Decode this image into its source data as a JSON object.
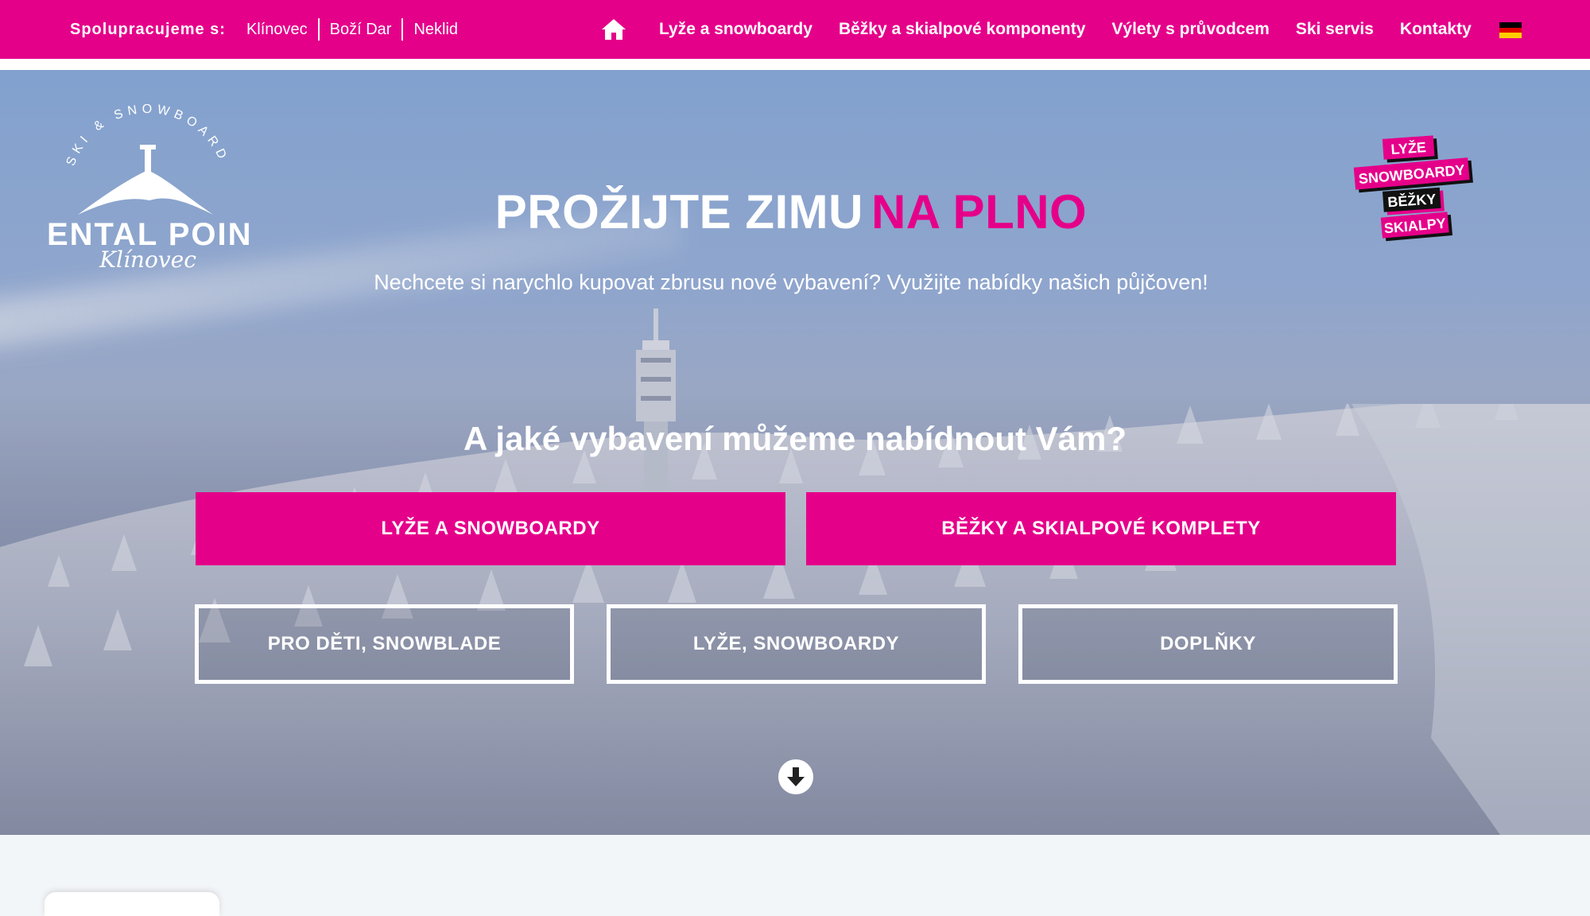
{
  "topbar": {
    "partners_label": "Spolupracujeme s:",
    "partners": [
      "Klínovec",
      "Boží Dar",
      "Neklid"
    ],
    "home_icon": "home-icon",
    "nav": [
      "Lyže a snowboardy",
      "Běžky a skialpové komponenty",
      "Výlety s průvodcem",
      "Ski servis",
      "Kontakty"
    ],
    "language_flag": "german-flag-icon"
  },
  "logo": {
    "arc_text": "SKI & SNOWBOARD",
    "name": "RENTAL POINT",
    "script": "Klínovec"
  },
  "sticker": [
    "LYŽE",
    "SNOWBOARDY",
    "BĚŽKY",
    "SKIALPY"
  ],
  "hero": {
    "headline_white": "PROŽIJTE ZIMU",
    "headline_pink": "NA PLNO",
    "subline": "Nechcete si narychlo kupovat zbrusu nové vybavení? Využijte nabídky našich půjčoven!",
    "question": "A jaké vybavení můžeme nabídnout Vám?",
    "primary_buttons": [
      "LYŽE A SNOWBOARDY",
      "BĚŽKY A SKIALPOVÉ KOMPLETY"
    ],
    "secondary_buttons": [
      "PRO DĚTI, SNOWBLADE",
      "LYŽE, SNOWBOARDY",
      "DOPLŇKY"
    ],
    "scroll_icon": "arrow-down-circle-icon"
  },
  "colors": {
    "brand_pink": "#e5008a",
    "white": "#ffffff"
  }
}
